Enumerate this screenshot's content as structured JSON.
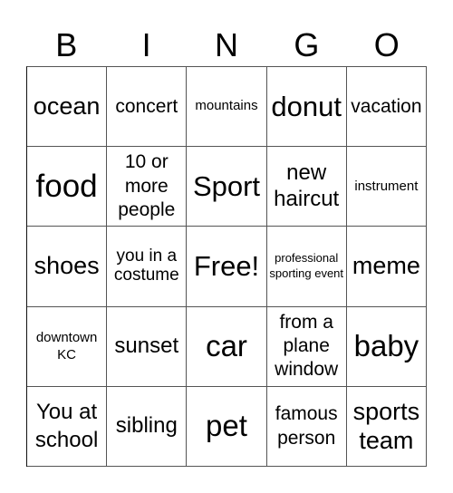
{
  "header": [
    "B",
    "I",
    "N",
    "G",
    "O"
  ],
  "cells": [
    [
      "ocean",
      "concert",
      "mountains",
      "donut",
      "vacation"
    ],
    [
      "food",
      "10 or more people",
      "Sport",
      "new haircut",
      "instrument"
    ],
    [
      "shoes",
      "you in a costume",
      "Free!",
      "professional sporting event",
      "meme"
    ],
    [
      "downtown KC",
      "sunset",
      "car",
      "from a plane window",
      "baby"
    ],
    [
      "You at school",
      "sibling",
      "pet",
      "famous person",
      "sports team"
    ]
  ]
}
